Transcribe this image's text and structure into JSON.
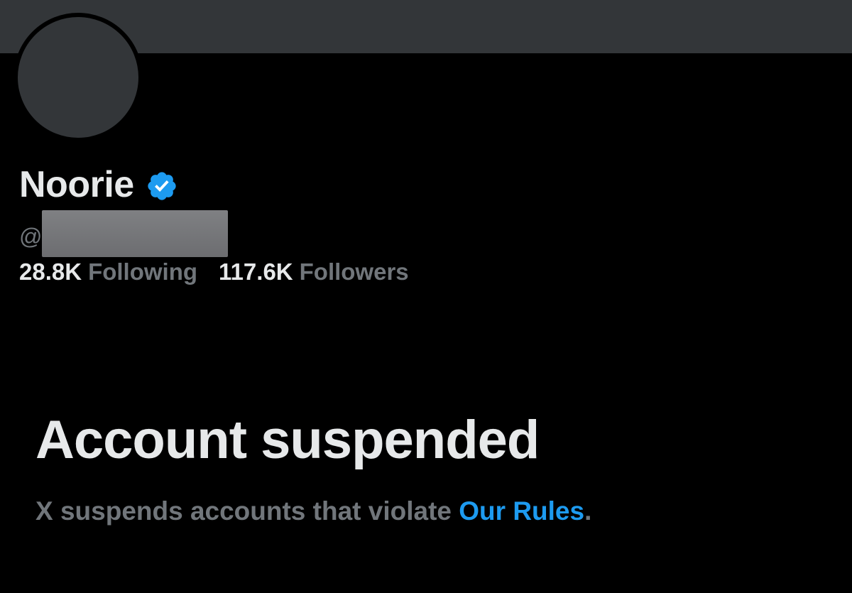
{
  "profile": {
    "display_name": "Noorie",
    "handle_prefix": "@",
    "verified_icon": "verified-badge-icon",
    "verified_color": "#1d9bf0"
  },
  "stats": {
    "following_count": "28.8K",
    "following_label": "Following",
    "followers_count": "117.6K",
    "followers_label": "Followers"
  },
  "suspension": {
    "title": "Account suspended",
    "message": "X suspends accounts that violate ",
    "link_label": "Our Rules",
    "trailing": "."
  },
  "colors": {
    "background": "#000000",
    "banner": "#333639",
    "primary_text": "#e7e9ea",
    "secondary_text": "#71767b",
    "link": "#1d9bf0"
  }
}
